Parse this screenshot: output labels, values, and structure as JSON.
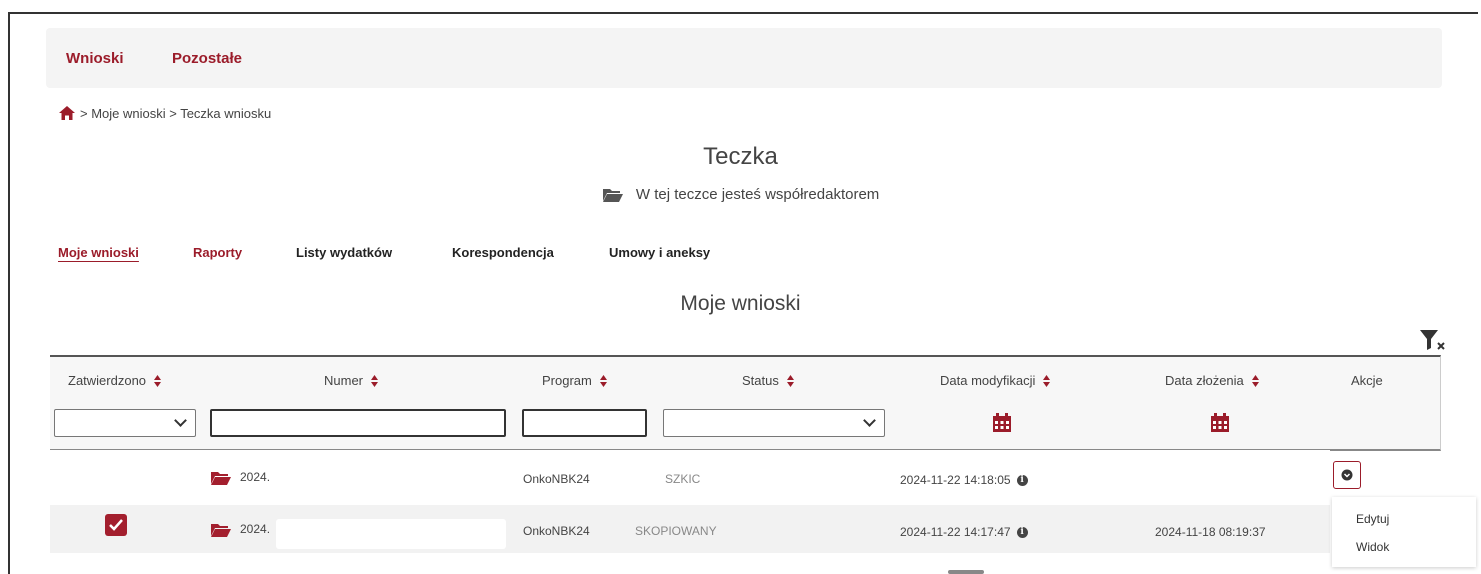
{
  "nav": {
    "items": [
      "Wnioski",
      "Pozostałe"
    ]
  },
  "breadcrumb": {
    "text": "> Moje wnioski > Teczka wniosku",
    "home_icon": "home-icon"
  },
  "page": {
    "title": "Teczka",
    "subtitle": "W tej teczce jesteś współredaktorem"
  },
  "tabs": [
    "Moje wnioski",
    "Raporty",
    "Listy wydatków",
    "Korespondencja",
    "Umowy i aneksy"
  ],
  "section": {
    "title": "Moje wnioski"
  },
  "table": {
    "headers": [
      "Zatwierdzono",
      "Numer",
      "Program",
      "Status",
      "Data modyfikacji",
      "Data złożenia",
      "Akcje"
    ],
    "rows": [
      {
        "approved": false,
        "numer": "2024.",
        "program": "OnkoNBK24",
        "status": "SZKIC",
        "data_modyfikacji": "2024-11-22 14:18:05",
        "data_zlozenia": ""
      },
      {
        "approved": true,
        "numer": "2024.",
        "program": "OnkoNBK24",
        "status": "SKOPIOWANY",
        "data_modyfikacji": "2024-11-22 14:17:47",
        "data_zlozenia": "2024-11-18 08:19:37"
      }
    ]
  },
  "actions_menu": [
    "Edytuj",
    "Widok"
  ],
  "colors": {
    "accent": "#9b1c2a",
    "checkbox": "#a31f2e"
  }
}
